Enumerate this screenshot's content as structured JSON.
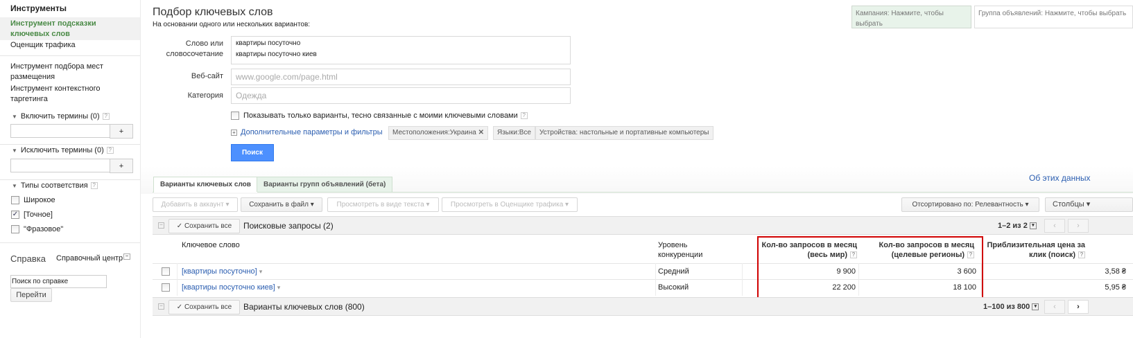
{
  "sidebar": {
    "title": "Инструменты",
    "active_item": "Инструмент подсказки ключевых слов",
    "items": [
      "Оценщик трафика",
      "Инструмент подбора мест размещения",
      "Инструмент контекстного таргетинга"
    ],
    "include_terms": "Включить термины (0)",
    "exclude_terms": "Исключить термины (0)",
    "plus": "+",
    "match_types": "Типы соответствия",
    "match_options": [
      {
        "label": "Широкое",
        "checked": false
      },
      {
        "label": "[Точное]",
        "checked": true
      },
      {
        "label": "\"Фразовое\"",
        "checked": false
      }
    ],
    "help_title": "Справка",
    "help_center": "Справочный центр",
    "help_search_value": "Поиск по справке",
    "go_button": "Перейти"
  },
  "header": {
    "title": "Подбор ключевых слов",
    "subtitle": "На основании одного или нескольких вариантов:",
    "campaign_selector": "Кампания: Нажмите, чтобы выбрать",
    "adgroup_selector": "Группа объявлений: Нажмите, чтобы выбрать"
  },
  "form": {
    "word_label": "Слово или словосочетание",
    "word_lines": [
      "квартиры посуточно",
      "квартиры посуточно киев"
    ],
    "website_label": "Веб-сайт",
    "website_placeholder": "www.google.com/page.html",
    "category_label": "Категория",
    "category_placeholder": "Одежда",
    "close_only_label": "Показывать только варианты, тесно связанные с моими ключевыми словами",
    "advanced_link": "Дополнительные параметры и фильтры",
    "chips": {
      "location": "Местоположения:Украина",
      "languages": "Языки:Все",
      "devices": "Устройства: настольные и портативные компьютеры"
    },
    "search_button": "Поиск"
  },
  "tabs": [
    "Варианты ключевых слов",
    "Варианты групп объявлений (бета)"
  ],
  "about_link": "Об этих данных",
  "toolbar": {
    "add": "Добавить в аккаунт",
    "save_file": "Сохранить в файл",
    "view_text": "Просмотреть в виде текста",
    "view_estimator": "Просмотреть в Оценщике трафика",
    "sorted": "Отсортировано по: Релевантность",
    "columns": "Столбцы"
  },
  "section1": {
    "save_all": "✓ Сохранить все",
    "title": "Поисковые запросы (2)",
    "pager": "1–2 из 2"
  },
  "columns": {
    "keyword": "Ключевое слово",
    "competition": "Уровень конкуренции",
    "global": "Кол-во запросов в месяц (весь мир)",
    "local": "Кол-во запросов в месяц (целевые регионы)",
    "cpc": "Приблизительная цена за клик (поиск)"
  },
  "rows": [
    {
      "keyword_prefix": "[квартиры посуточно",
      "keyword_extra": "",
      "keyword_suffix": "]",
      "competition": "Средний",
      "global": "9 900",
      "local": "3 600",
      "cpc": "3,58 ₴"
    },
    {
      "keyword_prefix": "[квартиры посуточно ",
      "keyword_extra": "киев",
      "keyword_suffix": "]",
      "competition": "Высокий",
      "global": "22 200",
      "local": "18 100",
      "cpc": "5,95 ₴"
    }
  ],
  "section2": {
    "save_all": "✓ Сохранить все",
    "title": "Варианты ключевых слов (800)",
    "pager": "1–100 из 800"
  },
  "colors": {
    "accent": "#4d90fe",
    "highlight": "#d00000",
    "green": "#4a8a46"
  }
}
